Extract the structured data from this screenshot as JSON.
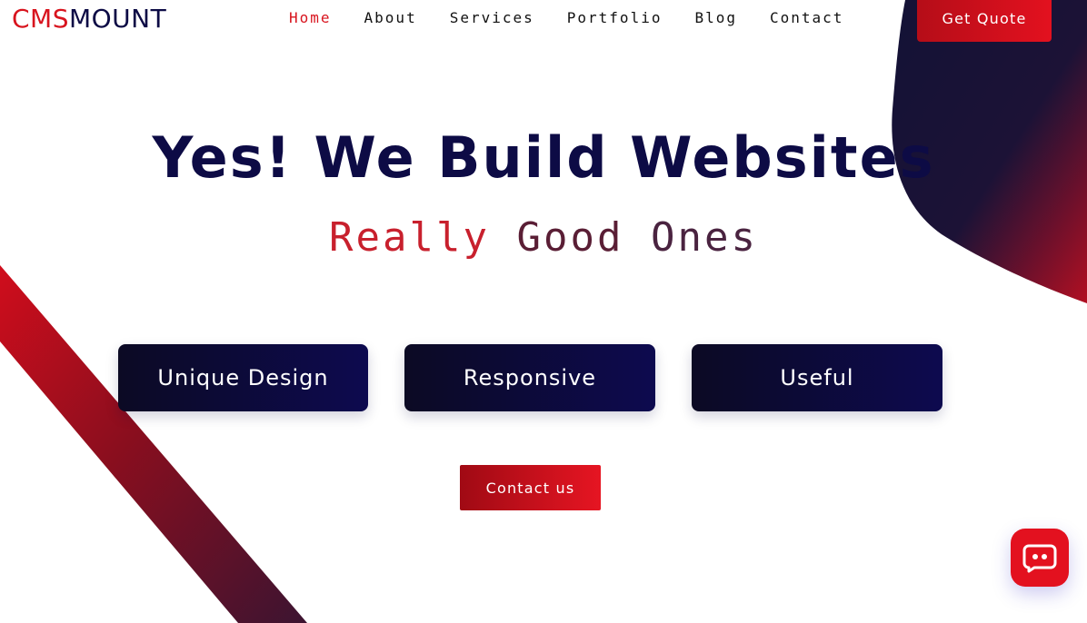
{
  "header": {
    "logo_part1": "CMS",
    "logo_part2": "MOUNT",
    "nav": [
      "Home",
      "About",
      "Services",
      "Portfolio",
      "Blog",
      "Contact"
    ],
    "active_nav": "Home",
    "quote_label": "Get Quote"
  },
  "hero": {
    "title": "Yes! We Build Websites",
    "sub_word1": "Really",
    "sub_word2": "Good",
    "sub_word3": "Ones"
  },
  "features": [
    "Unique Design",
    "Responsive",
    "Useful"
  ],
  "cta": {
    "contact_label": "Contact us"
  },
  "chat": {
    "icon": "chat-bot-icon"
  },
  "colors": {
    "brand_red": "#d8141e",
    "brand_navy": "#0d0b45",
    "card_dark": "#0c0a24",
    "card_navy": "#0d0a4f"
  }
}
